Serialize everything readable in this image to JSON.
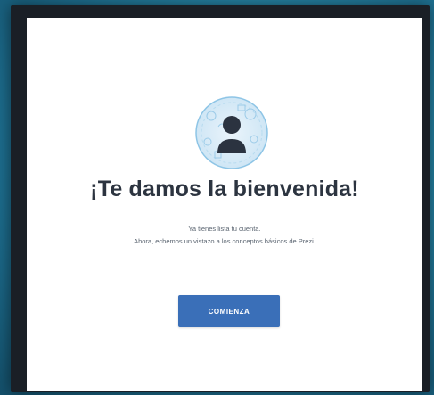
{
  "welcome": {
    "title": "¡Te damos la bienvenida!",
    "subtitle_line1": "Ya tienes lista tu cuenta.",
    "subtitle_line2": "Ahora, echemos un vistazo a los conceptos básicos de Prezi.",
    "start_button_label": "COMIENZA",
    "avatar_icon": "user-avatar-icon",
    "accent_color": "#3a6fb8"
  }
}
